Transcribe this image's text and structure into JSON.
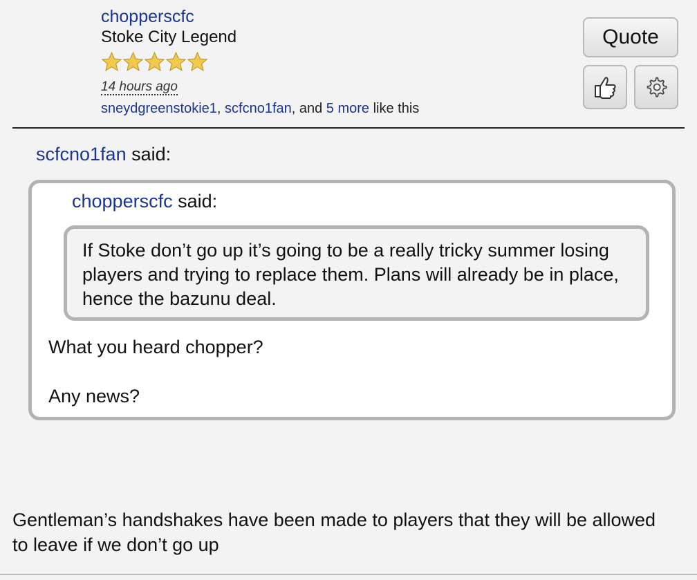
{
  "post": {
    "author": "chopperscfc",
    "author_title": "Stoke City Legend",
    "rating_stars": 5,
    "timestamp": "14 hours ago",
    "likes": {
      "users": [
        "sneydgreenstokie1",
        "scfcno1fan"
      ],
      "sep1": ", ",
      "sep2": ", and ",
      "more": "5 more",
      "suffix": " like this"
    },
    "buttons": {
      "quote_label": "Quote",
      "like_icon": "thumbs-up-icon",
      "settings_icon": "gear-icon"
    },
    "outer_quote": {
      "author": "scfcno1fan",
      "said": " said:"
    },
    "inner_quote": {
      "author": "chopperscfc",
      "said": " said:",
      "text": "If Stoke don’t go up it’s going to be a really tricky summer losing players and trying to replace them. Plans will already be in place, hence the bazunu deal."
    },
    "reply_lines": [
      "What you heard chopper?",
      "Any news?"
    ],
    "body": "Gentleman’s handshakes have been made to players that they will be allowed to leave if we don’t go up"
  },
  "colors": {
    "link": "#1a3494",
    "background": "#f3f3f3",
    "quote_border": "#b3b3b3",
    "star": "#f2c94c"
  }
}
